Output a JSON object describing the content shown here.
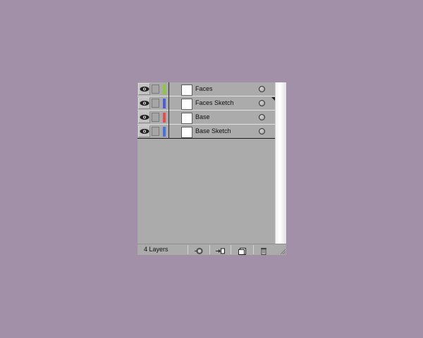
{
  "layers": [
    {
      "name": "Faces",
      "color": "#8dc63f",
      "visible": true
    },
    {
      "name": "Faces Sketch",
      "color": "#4a5fd0",
      "visible": true
    },
    {
      "name": "Base",
      "color": "#e05050",
      "visible": true
    },
    {
      "name": "Base Sketch",
      "color": "#4a72d8",
      "visible": true
    }
  ],
  "footer": {
    "layer_count": "4 Layers",
    "buttons": [
      "make-clipping-mask-icon",
      "create-sublayer-icon",
      "create-new-layer-icon",
      "delete-layer-icon"
    ]
  },
  "colors": {
    "background": "#a28fa8",
    "panel": "#ababab"
  }
}
